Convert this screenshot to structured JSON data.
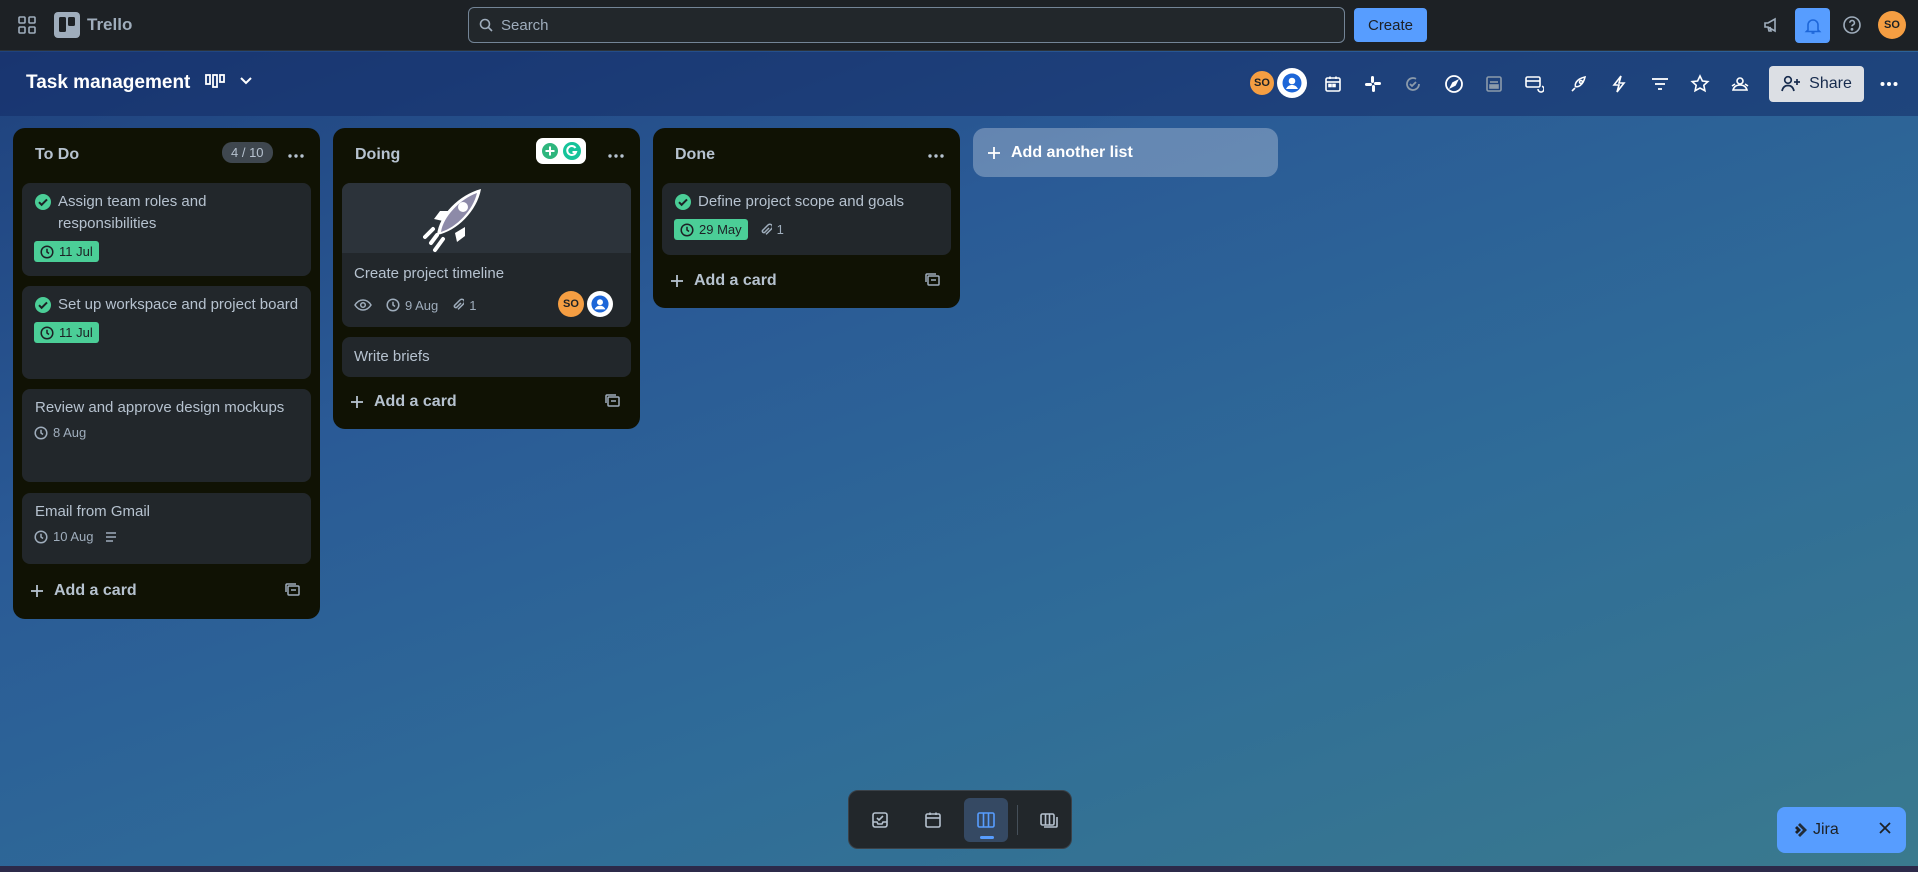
{
  "topnav": {
    "app_name": "Trello",
    "search_placeholder": "Search",
    "create_label": "Create",
    "user_initials": "SO",
    "icons": [
      "apps-grid-icon",
      "megaphone-icon",
      "notification-bell-icon",
      "help-icon"
    ]
  },
  "board": {
    "title": "Task management",
    "member_initials": "SO",
    "share_label": "Share",
    "colors": {
      "accent": "#579dff",
      "label_green": "#4bce97",
      "list_bg": "#101204",
      "card_bg": "#22272b"
    }
  },
  "lists": [
    {
      "title": "To Do",
      "count": "4 / 10",
      "cards": [
        {
          "title": "Assign team roles and responsibilities",
          "done": true,
          "due": "11 Jul"
        },
        {
          "title": "Set up workspace and project board",
          "done": true,
          "due": "11 Jul"
        },
        {
          "title": "Review and approve design mockups",
          "done": false,
          "due": "8 Aug"
        },
        {
          "title": "Email from Gmail",
          "done": false,
          "due": "10 Aug",
          "has_description": true
        }
      ],
      "add_card_label": "Add a card"
    },
    {
      "title": "Doing",
      "cards": [
        {
          "title": "Create project timeline",
          "cover": "rocket-sticker",
          "watching": true,
          "due": "9 Aug",
          "attachments": "1",
          "members": [
            "SO"
          ]
        },
        {
          "title": "Write briefs"
        }
      ],
      "add_card_label": "Add a card"
    },
    {
      "title": "Done",
      "cards": [
        {
          "title": "Define project scope and goals",
          "done": true,
          "due": "29 May",
          "attachments": "1"
        }
      ],
      "add_card_label": "Add a card"
    }
  ],
  "add_list_label": "Add another list",
  "view_switcher": {
    "items": [
      "inbox-icon",
      "calendar-icon",
      "board-icon",
      "switch-boards-icon"
    ],
    "active": "board-icon"
  },
  "jira": {
    "label": "Jira"
  }
}
